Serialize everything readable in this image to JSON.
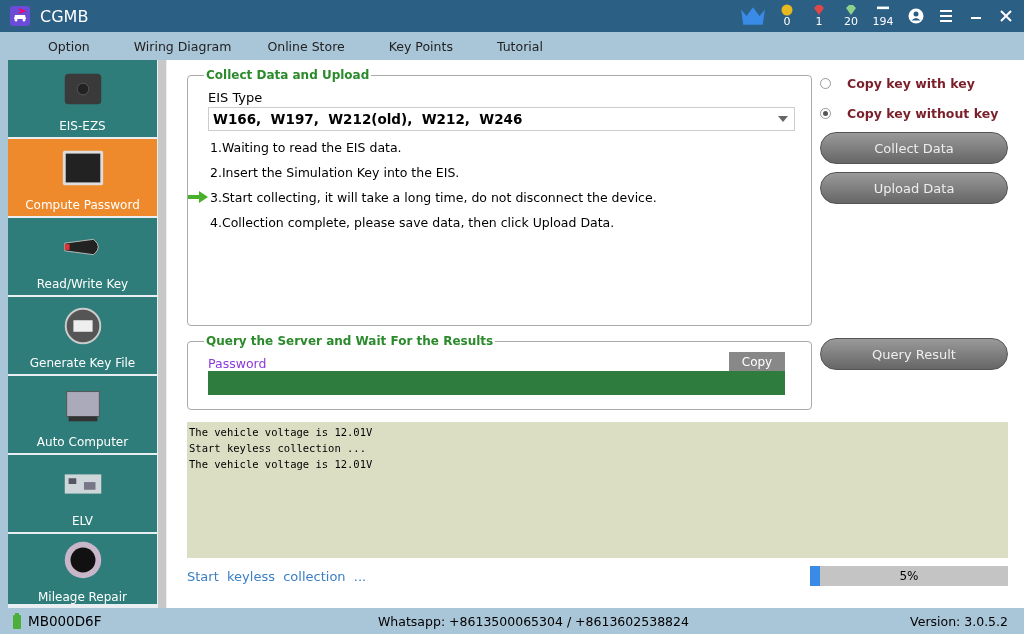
{
  "window": {
    "title": "CGMB",
    "counters": [
      {
        "kind": "coin",
        "value": "0"
      },
      {
        "kind": "ruby",
        "value": "1"
      },
      {
        "kind": "diamond",
        "value": "20"
      },
      {
        "kind": "days",
        "value": "194"
      }
    ]
  },
  "menu": [
    "Option",
    "Wiring Diagram",
    "Online Store",
    "Key Points",
    "Tutorial"
  ],
  "sidebar": {
    "items": [
      {
        "label": "EIS-EZS",
        "selected": false
      },
      {
        "label": "Compute Password",
        "selected": true
      },
      {
        "label": "Read/Write Key",
        "selected": false
      },
      {
        "label": "Generate Key File",
        "selected": false
      },
      {
        "label": "Auto Computer",
        "selected": false
      },
      {
        "label": "ELV",
        "selected": false
      },
      {
        "label": "Mileage Repair",
        "selected": false
      }
    ]
  },
  "collect": {
    "title": "Collect Data and Upload",
    "eis_label": "EIS Type",
    "eis_value": "W166,  W197,  W212(old),  W212,  W246",
    "steps": [
      {
        "text": "1.Waiting to read the EIS data.",
        "current": false
      },
      {
        "text": "2.Insert the Simulation Key into the EIS.",
        "current": false
      },
      {
        "text": "3.Start collecting, it will take a long time, do not disconnect the device.",
        "current": true
      },
      {
        "text": "4.Collection complete, please save data, then click Upload Data.",
        "current": false
      }
    ]
  },
  "modes": [
    {
      "label": "Copy key with key",
      "selected": false
    },
    {
      "label": "Copy key without key",
      "selected": true
    }
  ],
  "actions": [
    "Collect Data",
    "Upload Data"
  ],
  "query": {
    "title": "Query the Server and Wait For the Results",
    "password_label": "Password",
    "copy": "Copy",
    "button": "Query Result"
  },
  "log": [
    "The vehicle voltage is 12.01V",
    "Start keyless collection ...",
    "The vehicle voltage is 12.01V"
  ],
  "status_text": "Start  keyless  collection  ...",
  "progress": {
    "level": 0.05,
    "reading": "5%"
  },
  "status_bar": {
    "device": "MB000D6F",
    "contact": "Whatsapp: +8613500065304 / +8613602538824",
    "version": "Version: 3.0.5.2"
  }
}
